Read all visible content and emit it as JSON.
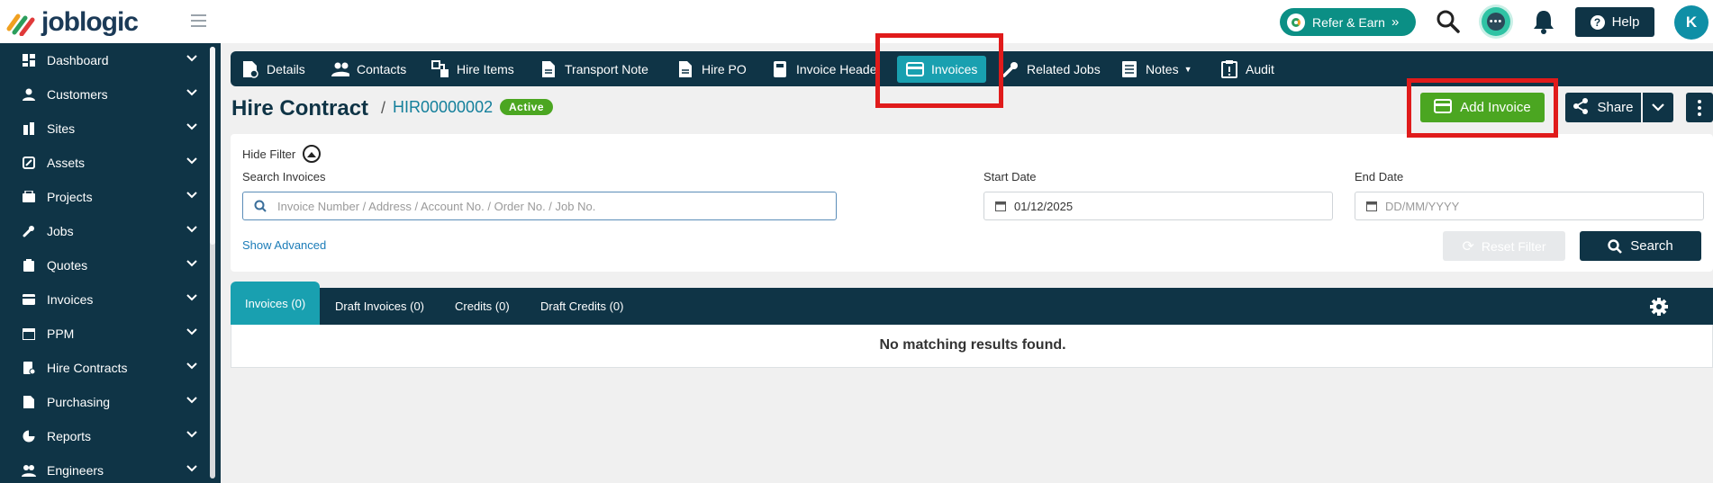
{
  "app": {
    "logo_text": "joblogic"
  },
  "topbar": {
    "refer_label": "Refer & Earn",
    "help_label": "Help",
    "avatar_initial": "K"
  },
  "sidebar": {
    "items": [
      {
        "label": "Dashboard",
        "icon": "dashboard-icon"
      },
      {
        "label": "Customers",
        "icon": "user-icon"
      },
      {
        "label": "Sites",
        "icon": "building-icon"
      },
      {
        "label": "Assets",
        "icon": "asset-icon"
      },
      {
        "label": "Projects",
        "icon": "projects-icon"
      },
      {
        "label": "Jobs",
        "icon": "wrench-icon"
      },
      {
        "label": "Quotes",
        "icon": "clipboard-icon"
      },
      {
        "label": "Invoices",
        "icon": "card-icon"
      },
      {
        "label": "PPM",
        "icon": "calendar-icon"
      },
      {
        "label": "Hire Contracts",
        "icon": "hire-contract-icon"
      },
      {
        "label": "Purchasing",
        "icon": "document-icon"
      },
      {
        "label": "Reports",
        "icon": "pie-chart-icon"
      },
      {
        "label": "Engineers",
        "icon": "engineers-icon"
      }
    ]
  },
  "tabs": [
    {
      "label": "Details",
      "icon": "details-icon"
    },
    {
      "label": "Contacts",
      "icon": "contacts-icon"
    },
    {
      "label": "Hire Items",
      "icon": "hire-items-icon"
    },
    {
      "label": "Transport Note",
      "icon": "document-icon"
    },
    {
      "label": "Hire PO",
      "icon": "document-icon"
    },
    {
      "label": "Invoice Heade",
      "icon": "calculator-icon"
    },
    {
      "label": "Invoices",
      "icon": "card-icon"
    },
    {
      "label": "Related Jobs",
      "icon": "wrench-icon"
    },
    {
      "label": "Notes",
      "icon": "notes-icon"
    },
    {
      "label": "Audit",
      "icon": "audit-icon"
    }
  ],
  "header": {
    "title": "Hire Contract",
    "separator": "/",
    "contract_id": "HIR00000002",
    "status": "Active",
    "add_invoice_label": "Add Invoice",
    "share_label": "Share"
  },
  "filter": {
    "hide_filter_label": "Hide Filter",
    "search_label": "Search Invoices",
    "search_placeholder": "Invoice Number / Address / Account No. / Order No. / Job No.",
    "start_date_label": "Start Date",
    "start_date_value": "01/12/2025",
    "end_date_label": "End Date",
    "end_date_placeholder": "DD/MM/YYYY",
    "show_advanced_label": "Show Advanced",
    "reset_label": "Reset Filter",
    "search_button_label": "Search"
  },
  "results": {
    "tabs": [
      {
        "label": "Invoices",
        "count": "(0)"
      },
      {
        "label": "Draft Invoices",
        "count": "(0)"
      },
      {
        "label": "Credits",
        "count": "(0)"
      },
      {
        "label": "Draft Credits",
        "count": "(0)"
      }
    ],
    "empty_message": "No matching results found."
  },
  "colors": {
    "navy": "#0f3446",
    "teal_active": "#19a0b0",
    "green": "#4ba621",
    "highlight_red": "#e01b1b"
  }
}
